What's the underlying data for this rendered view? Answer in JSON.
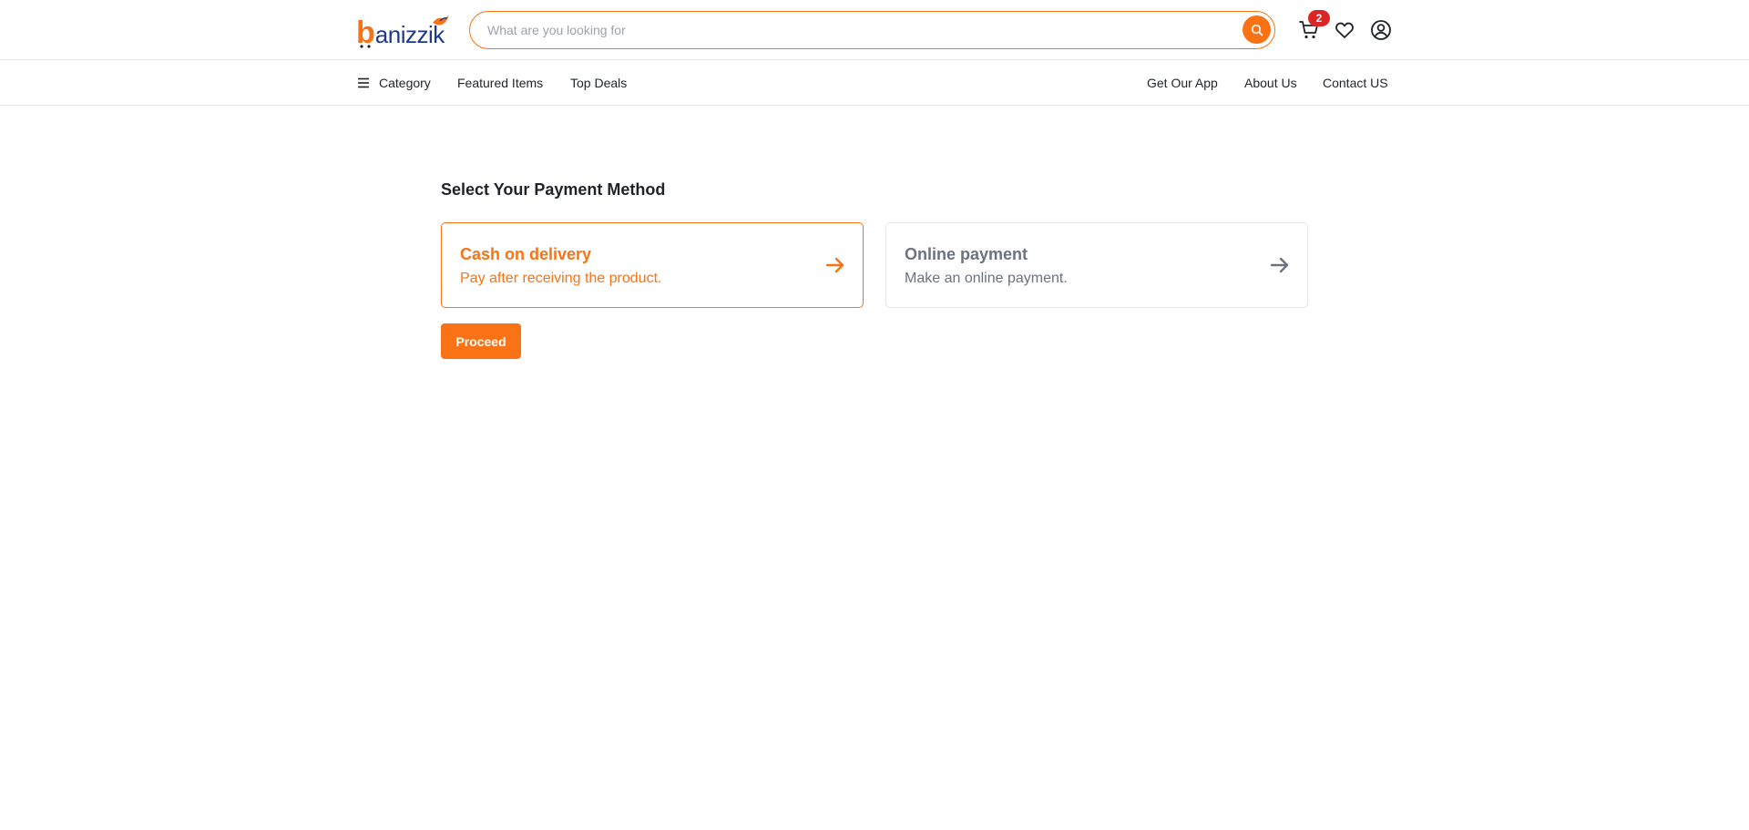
{
  "header": {
    "logo_text": "banizzik",
    "logo_first_letter": "b",
    "logo_rest": "anizzik",
    "search": {
      "placeholder": "What are you looking for",
      "value": ""
    },
    "cart_count": "2",
    "icons": [
      "search-icon",
      "cart-icon",
      "heart-icon",
      "user-icon"
    ]
  },
  "nav": {
    "category_label": "Category",
    "featured_label": "Featured Items",
    "topdeals_label": "Top Deals",
    "app_label": "Get Our App",
    "about_label": "About Us",
    "contact_label": "Contact US"
  },
  "main": {
    "title": "Select Your Payment Method",
    "methods": [
      {
        "title": "Cash on delivery",
        "subtitle": "Pay after receiving the product.",
        "selected": true
      },
      {
        "title": "Online payment",
        "subtitle": "Make an online payment.",
        "selected": false
      }
    ],
    "proceed_label": "Proceed"
  },
  "colors": {
    "accent": "#f97316",
    "badge": "#dc2626",
    "logo_blue": "#1e3a8a",
    "muted": "#6b7280",
    "border": "#e5e7eb"
  }
}
